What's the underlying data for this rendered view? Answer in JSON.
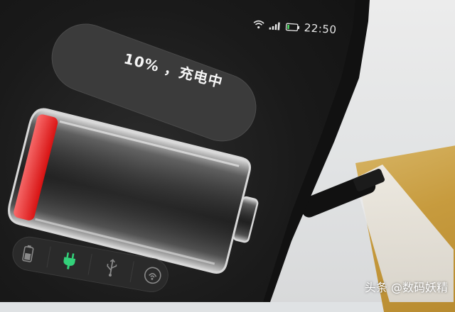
{
  "status_bar": {
    "time": "22:50",
    "icons": [
      "wifi-icon",
      "signal-icon",
      "battery-icon"
    ]
  },
  "charging": {
    "label": "10% ，充电中",
    "level": 0.1,
    "fill_color": "#ff3b3b"
  },
  "icon_bar": {
    "icons": [
      "battery-saver-icon",
      "plug-icon",
      "usb-icon",
      "wireless-charge-icon"
    ],
    "active_color": "#33d17a"
  },
  "watermark": "头条 @数码妖精"
}
